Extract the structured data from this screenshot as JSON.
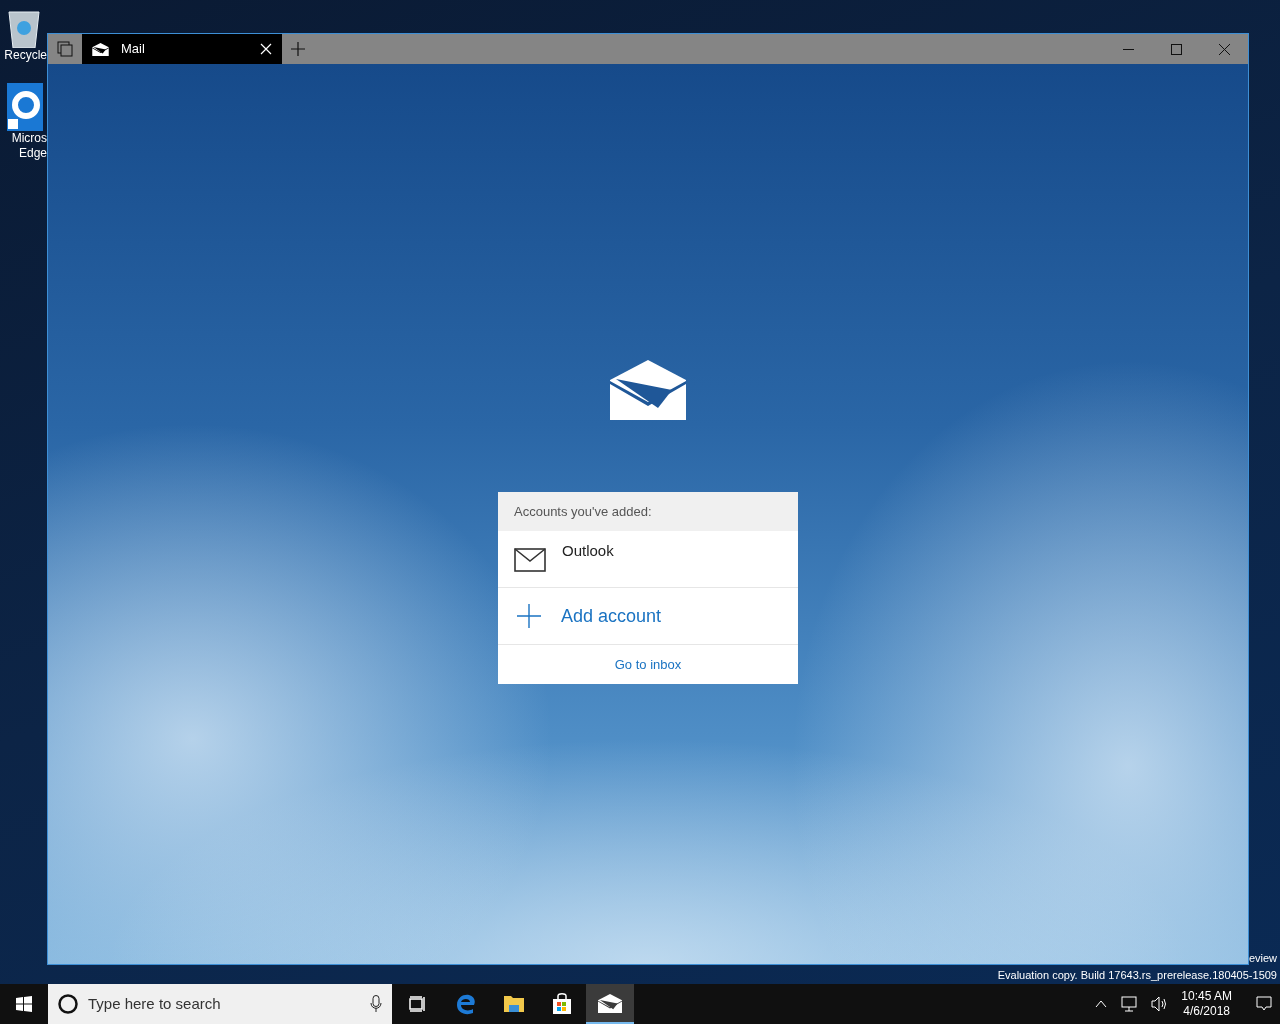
{
  "desktop_icons": [
    {
      "kind": "recycle-bin",
      "label_lines": [
        "Recycle"
      ]
    },
    {
      "kind": "edge",
      "label_lines": [
        "Micros",
        "Edge"
      ]
    }
  ],
  "window": {
    "tabs": [
      {
        "title": "Mail",
        "selected": true
      }
    ]
  },
  "accounts_panel": {
    "header": "Accounts you've added:",
    "accounts": [
      {
        "name": "Outlook"
      }
    ],
    "add_account": "Add account",
    "go_to_inbox": "Go to inbox"
  },
  "watermark_lines": [
    "eview",
    "Evaluation copy. Build 17643.rs_prerelease.180405-1509"
  ],
  "taskbar": {
    "search_placeholder": "Type here to search",
    "apps": [
      {
        "kind": "task-view",
        "active": false
      },
      {
        "kind": "edge",
        "active": false
      },
      {
        "kind": "explorer",
        "active": false
      },
      {
        "kind": "store",
        "active": false
      },
      {
        "kind": "mail",
        "active": true
      }
    ],
    "time": "10:45 AM",
    "date": "4/6/2018"
  }
}
